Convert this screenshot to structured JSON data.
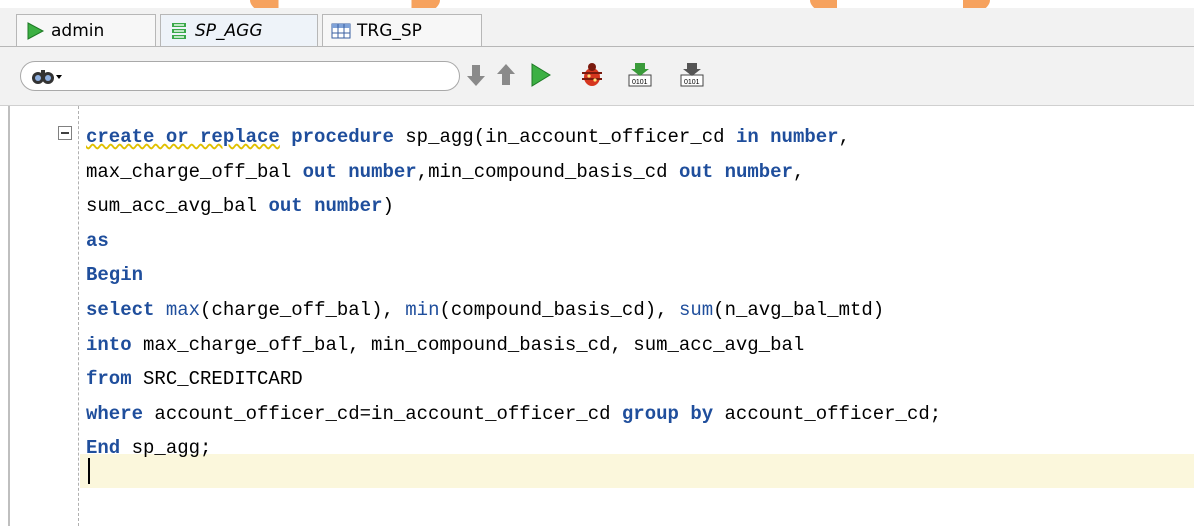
{
  "tabs": [
    {
      "label": "admin",
      "icon": "run-triangle-icon"
    },
    {
      "label": "SP_AGG",
      "icon": "procedure-icon"
    },
    {
      "label": "TRG_SP",
      "icon": "table-grid-icon"
    }
  ],
  "toolbar": {
    "search_placeholder": "",
    "buttons": [
      "arrow-down-icon",
      "arrow-up-icon",
      "run-icon",
      "debug-bug-icon",
      "compile-icon",
      "compile-debug-icon"
    ]
  },
  "code": {
    "lines": [
      [
        {
          "t": "create or replace",
          "k": "kw sq"
        },
        {
          "t": " "
        },
        {
          "t": "procedure",
          "k": "kw"
        },
        {
          "t": " sp_agg(in_account_officer_cd "
        },
        {
          "t": "in",
          "k": "kw"
        },
        {
          "t": " "
        },
        {
          "t": "number",
          "k": "kw"
        },
        {
          "t": ","
        }
      ],
      [
        {
          "t": "max_charge_off_bal "
        },
        {
          "t": "out",
          "k": "kw"
        },
        {
          "t": " "
        },
        {
          "t": "number",
          "k": "kw"
        },
        {
          "t": ",min_compound_basis_cd "
        },
        {
          "t": "out",
          "k": "kw"
        },
        {
          "t": " "
        },
        {
          "t": "number",
          "k": "kw"
        },
        {
          "t": ","
        }
      ],
      [
        {
          "t": "sum_acc_avg_bal "
        },
        {
          "t": "out",
          "k": "kw"
        },
        {
          "t": " "
        },
        {
          "t": "number",
          "k": "kw"
        },
        {
          "t": ")"
        }
      ],
      [
        {
          "t": "as",
          "k": "kw"
        }
      ],
      [
        {
          "t": "Begin",
          "k": "kw"
        }
      ],
      [
        {
          "t": "select",
          "k": "kw"
        },
        {
          "t": " "
        },
        {
          "t": "max",
          "k": "fn"
        },
        {
          "t": "(charge_off_bal), "
        },
        {
          "t": "min",
          "k": "fn"
        },
        {
          "t": "(compound_basis_cd), "
        },
        {
          "t": "sum",
          "k": "fn"
        },
        {
          "t": "(n_avg_bal_mtd)"
        }
      ],
      [
        {
          "t": "into",
          "k": "kw"
        },
        {
          "t": " max_charge_off_bal, min_compound_basis_cd, sum_acc_avg_bal"
        }
      ],
      [
        {
          "t": "from",
          "k": "kw"
        },
        {
          "t": " SRC_CREDITCARD"
        }
      ],
      [
        {
          "t": "where",
          "k": "kw"
        },
        {
          "t": " account_officer_cd=in_account_officer_cd "
        },
        {
          "t": "group by",
          "k": "kw"
        },
        {
          "t": " account_officer_cd;"
        }
      ],
      [
        {
          "t": "End",
          "k": "kw"
        },
        {
          "t": " sp_agg;"
        }
      ]
    ]
  },
  "colors": {
    "keyword": "#1f4e9c",
    "current_line": "#fbf7dc",
    "accent_deco": "#f6a25e"
  }
}
